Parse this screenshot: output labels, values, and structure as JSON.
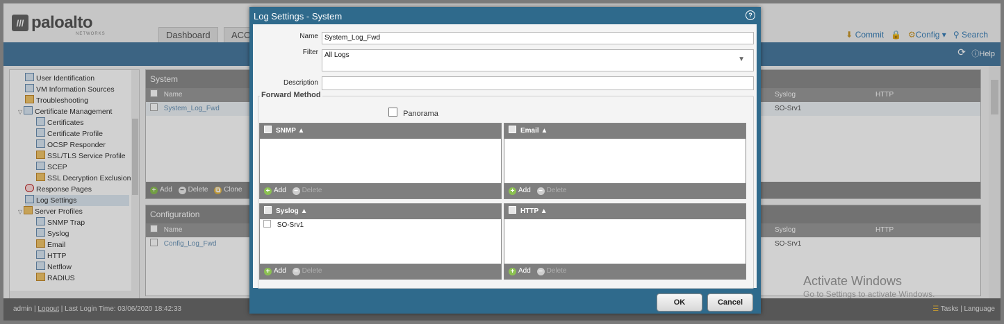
{
  "header": {
    "logo_text": "paloalto",
    "logo_sub": "NETWORKS",
    "tabs": [
      "Dashboard",
      "ACC"
    ],
    "actions": {
      "commit": "Commit",
      "config": "Config",
      "search": "Search"
    },
    "help": "Help"
  },
  "sidebar": {
    "items": [
      "User Identification",
      "VM Information Sources",
      "Troubleshooting",
      "Certificate Management",
      "Certificates",
      "Certificate Profile",
      "OCSP Responder",
      "SSL/TLS Service Profile",
      "SCEP",
      "SSL Decryption Exclusion",
      "Response Pages",
      "Log Settings",
      "Server Profiles",
      "SNMP Trap",
      "Syslog",
      "Email",
      "HTTP",
      "Netflow",
      "RADIUS"
    ]
  },
  "system_panel": {
    "title": "System",
    "col_name": "Name",
    "col_syslog": "Syslog",
    "col_http": "HTTP",
    "row_name": "System_Log_Fwd",
    "row_syslog": "SO-Srv1",
    "add": "Add",
    "delete": "Delete",
    "clone": "Clone"
  },
  "config_panel": {
    "title": "Configuration",
    "col_name": "Name",
    "col_syslog": "Syslog",
    "col_http": "HTTP",
    "row_name": "Config_Log_Fwd",
    "row_syslog": "SO-Srv1"
  },
  "watermark": {
    "line1": "Activate Windows",
    "line2": "Go to Settings to activate Windows."
  },
  "status_bar": {
    "user": "admin",
    "logout": "Logout",
    "last_login": "Last Login Time: 03/06/2020 18:42:33",
    "tasks": "Tasks",
    "language": "Language"
  },
  "modal": {
    "title": "Log Settings - System",
    "name_label": "Name",
    "name_value": "System_Log_Fwd",
    "filter_label": "Filter",
    "filter_value": "All Logs",
    "description_label": "Description",
    "description_value": "",
    "forward_method": "Forward Method",
    "panorama_label": "Panorama",
    "panorama_checked": false,
    "grids": {
      "snmp": {
        "header": "SNMP",
        "rows": []
      },
      "email": {
        "header": "Email",
        "rows": []
      },
      "syslog": {
        "header": "Syslog",
        "rows": [
          "SO-Srv1"
        ]
      },
      "http": {
        "header": "HTTP",
        "rows": []
      }
    },
    "add_label": "Add",
    "delete_label": "Delete",
    "ok_label": "OK",
    "cancel_label": "Cancel"
  }
}
